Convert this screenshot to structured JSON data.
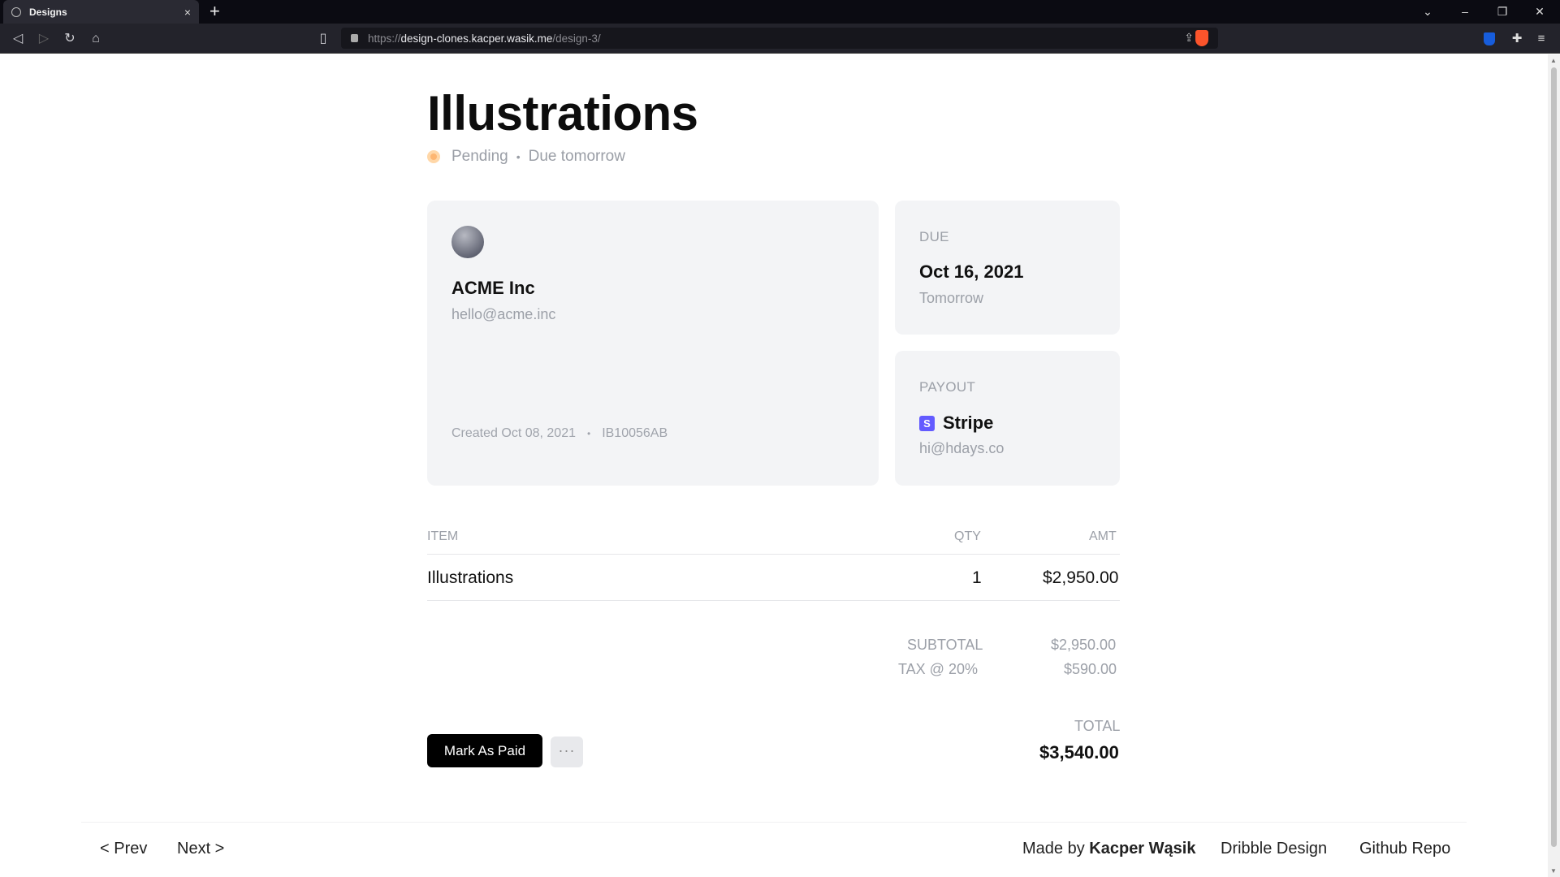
{
  "browser": {
    "tab_title": "Designs",
    "tab_close": "×",
    "new_tab": "+",
    "url_scheme": "https://",
    "url_host": "design-clones.kacper.wasik.me",
    "url_path": "/design-3/",
    "icons": [
      "back-icon",
      "forward-icon",
      "reload-icon",
      "home-icon",
      "bookmark-icon",
      "share-icon",
      "brave-shield-icon",
      "bitwarden-icon",
      "extensions-icon",
      "menu-icon"
    ]
  },
  "invoice": {
    "title": "Illustrations",
    "status": "Pending",
    "status_sep": "•",
    "due_text": "Due tomorrow",
    "status_color": "#fdb672",
    "client": {
      "name": "ACME Inc",
      "email": "hello@acme.inc",
      "created": "Created Oct 08, 2021",
      "bullet": "•",
      "invoice_id": "IB10056AB"
    },
    "due": {
      "label": "DUE",
      "date": "Oct 16, 2021",
      "relative": "Tomorrow"
    },
    "payout": {
      "label": "PAYOUT",
      "method": "Stripe",
      "method_icon_letter": "S",
      "email": "hi@hdays.co",
      "brand_color": "#635bff"
    },
    "table": {
      "headers": {
        "item": "ITEM",
        "qty": "QTY",
        "amt": "AMT"
      },
      "rows": [
        {
          "item": "Illustrations",
          "qty": "1",
          "amt": "$2,950.00"
        }
      ]
    },
    "summary": {
      "subtotal_label": "SUBTOTAL",
      "subtotal_value": "$2,950.00",
      "tax_label": "TAX @ 20%",
      "tax_value": "$590.00",
      "total_label": "TOTAL",
      "total_value": "$3,540.00"
    },
    "actions": {
      "mark_paid": "Mark As Paid",
      "more": "···"
    }
  },
  "footer": {
    "prev": "< Prev",
    "next": "Next >",
    "made_by_prefix": "Made by",
    "made_by_name": "Kacper Wąsik",
    "dribbble": "Dribble Design",
    "github": "Github Repo"
  }
}
